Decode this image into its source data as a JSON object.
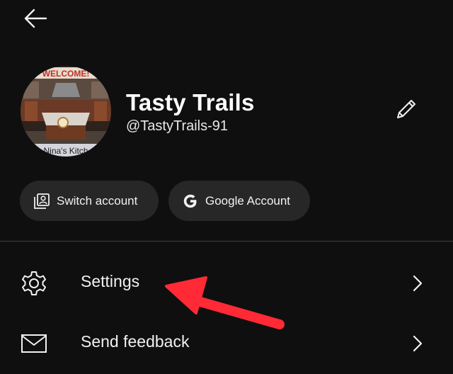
{
  "header": {
    "back_icon": "arrow-left-icon"
  },
  "profile": {
    "channel_name": "Tasty Trails",
    "handle": "@TastyTrails-91",
    "avatar_banner_text": "WELCOME!",
    "avatar_caption_text": "Nina's Kitch",
    "edit_icon": "pencil-icon"
  },
  "chips": [
    {
      "label": "Switch account",
      "icon": "switch-account-icon"
    },
    {
      "label": "Google Account",
      "icon": "google-g-icon"
    }
  ],
  "menu": [
    {
      "label": "Settings",
      "icon": "gear-icon"
    },
    {
      "label": "Send feedback",
      "icon": "mail-icon"
    }
  ],
  "annotation": {
    "color": "#ff2a36",
    "type": "red-arrow-pointing-at-settings"
  },
  "colors": {
    "background": "#0f0f0f",
    "chip_background": "#272727",
    "divider": "#3d3d3d",
    "text": "#f1f1f1"
  }
}
